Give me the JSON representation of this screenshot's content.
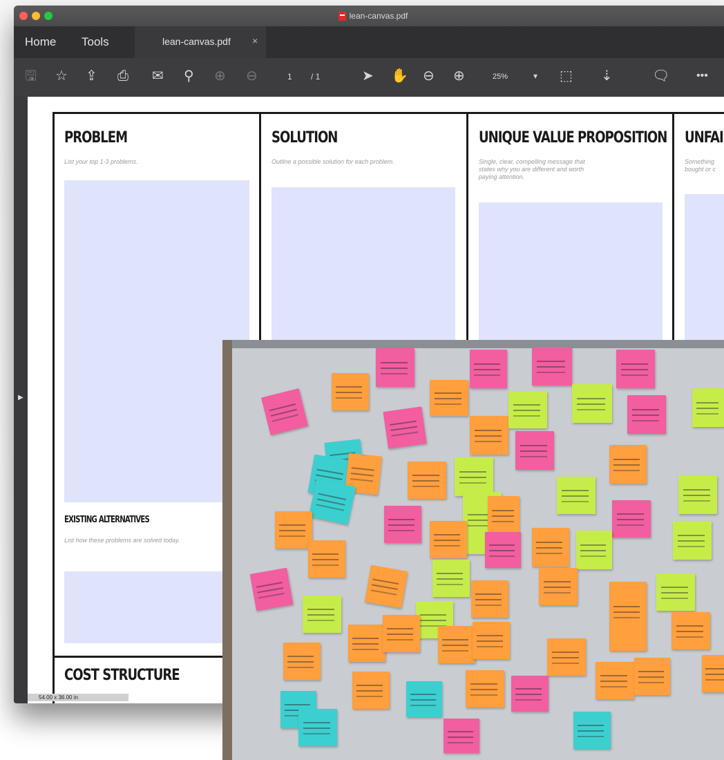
{
  "window": {
    "title": "lean-canvas.pdf"
  },
  "tabs": {
    "home": "Home",
    "tools": "Tools",
    "document": "lean-canvas.pdf",
    "close": "×"
  },
  "toolbar": {
    "page_current": "1",
    "page_total": "/ 1",
    "zoom": "25%"
  },
  "canvas": {
    "problem": {
      "title": "PROBLEM",
      "subtitle": "List your top 1-3 problems."
    },
    "solution": {
      "title": "SOLUTION",
      "subtitle": "Outline a possible solution for each problem."
    },
    "uvp": {
      "title": "UNIQUE VALUE PROPOSITION",
      "subtitle": "Single, clear, compelling message that states why you are different and worth paying attention."
    },
    "unfair": {
      "title": "UNFAI",
      "subtitle": "Something bought or c"
    },
    "alternatives": {
      "title": "EXISTING ALTERNATIVES",
      "subtitle": "List how these problems are solved today."
    },
    "cost": {
      "title": "COST STRUCTURE"
    }
  },
  "status": {
    "page_size": "54.00 x 36.00 in"
  },
  "colors": {
    "note_pink": "#f25ea0",
    "note_orange": "#ff9f3d",
    "note_green": "#c6ec4a",
    "note_cyan": "#3ccfd0",
    "canvas_blue": "#dfe3fb"
  }
}
